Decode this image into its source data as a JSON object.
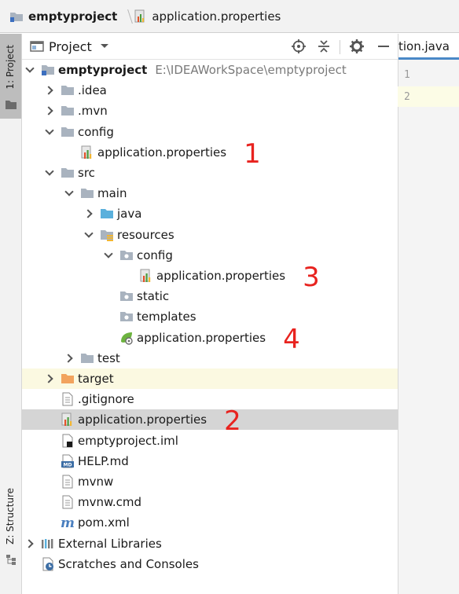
{
  "breadcrumb": {
    "project": "emptyproject",
    "file": "application.properties"
  },
  "left_strip": {
    "project_tab": "1: Project",
    "structure_tab": "Z: Structure"
  },
  "panel": {
    "title": "Project"
  },
  "editor": {
    "tab_label": "tion.java",
    "line_numbers": [
      "1",
      "2"
    ]
  },
  "tree": [
    {
      "label": "emptyproject",
      "path": "E:\\IDEAWorkSpace\\emptyproject",
      "depth": 0,
      "chevron": "down",
      "icon": "module-icon",
      "bold": true
    },
    {
      "label": ".idea",
      "depth": 1,
      "chevron": "right",
      "icon": "folder-icon"
    },
    {
      "label": ".mvn",
      "depth": 1,
      "chevron": "right",
      "icon": "folder-icon"
    },
    {
      "label": "config",
      "depth": 1,
      "chevron": "down",
      "icon": "folder-icon"
    },
    {
      "label": "application.properties",
      "depth": 2,
      "chevron": "none",
      "icon": "properties-file-icon",
      "marker": "1"
    },
    {
      "label": "src",
      "depth": 1,
      "chevron": "down",
      "icon": "folder-icon"
    },
    {
      "label": "main",
      "depth": 2,
      "chevron": "down",
      "icon": "folder-icon"
    },
    {
      "label": "java",
      "depth": 3,
      "chevron": "right",
      "icon": "source-folder-icon"
    },
    {
      "label": "resources",
      "depth": 3,
      "chevron": "down",
      "icon": "resources-folder-icon"
    },
    {
      "label": "config",
      "depth": 4,
      "chevron": "down",
      "icon": "package-folder-icon"
    },
    {
      "label": "application.properties",
      "depth": 5,
      "chevron": "none",
      "icon": "properties-file-icon",
      "marker": "3"
    },
    {
      "label": "static",
      "depth": 4,
      "chevron": "none",
      "icon": "package-folder-icon"
    },
    {
      "label": "templates",
      "depth": 4,
      "chevron": "none",
      "icon": "package-folder-icon"
    },
    {
      "label": "application.properties",
      "depth": 4,
      "chevron": "none",
      "icon": "spring-config-icon",
      "marker": "4"
    },
    {
      "label": "test",
      "depth": 2,
      "chevron": "right",
      "icon": "folder-icon"
    },
    {
      "label": "target",
      "depth": 1,
      "chevron": "right",
      "icon": "excluded-folder-icon",
      "highlight": "yellow"
    },
    {
      "label": ".gitignore",
      "depth": 1,
      "chevron": "none",
      "icon": "text-file-icon"
    },
    {
      "label": "application.properties",
      "depth": 1,
      "chevron": "none",
      "icon": "properties-file-icon",
      "marker": "2",
      "highlight": "selected"
    },
    {
      "label": "emptyproject.iml",
      "depth": 1,
      "chevron": "none",
      "icon": "iml-file-icon"
    },
    {
      "label": "HELP.md",
      "depth": 1,
      "chevron": "none",
      "icon": "markdown-file-icon"
    },
    {
      "label": "mvnw",
      "depth": 1,
      "chevron": "none",
      "icon": "text-file-icon"
    },
    {
      "label": "mvnw.cmd",
      "depth": 1,
      "chevron": "none",
      "icon": "text-file-icon"
    },
    {
      "label": "pom.xml",
      "depth": 1,
      "chevron": "none",
      "icon": "maven-icon"
    },
    {
      "label": "External Libraries",
      "depth": 0,
      "chevron": "right",
      "icon": "libraries-icon"
    },
    {
      "label": "Scratches and Consoles",
      "depth": 0,
      "chevron": "none",
      "icon": "scratches-icon"
    }
  ],
  "colors": {
    "folder": "#a9b3bf",
    "source_folder": "#5ab0dc",
    "excluded_folder": "#f2a35e",
    "marker_red": "#e8231f",
    "selection": "#d5d5d5"
  }
}
